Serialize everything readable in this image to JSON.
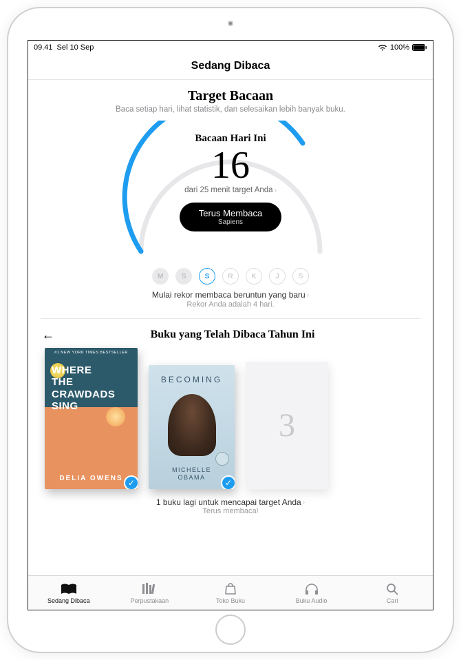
{
  "status": {
    "time": "09.41",
    "date": "Sel 10 Sep",
    "battery": "100%"
  },
  "nav": {
    "title": "Sedang Dibaca"
  },
  "goals": {
    "title": "Target Bacaan",
    "subtitle": "Baca setiap hari, lihat statistik, dan selesaikan lebih banyak buku.",
    "today_label": "Bacaan Hari Ini",
    "today_value": "16",
    "target_text": "dari 25 menit target Anda",
    "continue_label": "Terus Membaca",
    "continue_book": "Sapiens",
    "days": [
      {
        "letter": "M",
        "state": "filled"
      },
      {
        "letter": "S",
        "state": "filled"
      },
      {
        "letter": "S",
        "state": "active"
      },
      {
        "letter": "R",
        "state": ""
      },
      {
        "letter": "K",
        "state": ""
      },
      {
        "letter": "J",
        "state": ""
      },
      {
        "letter": "S",
        "state": ""
      }
    ],
    "streak_text": "Mulai rekor membaca beruntun yang baru",
    "streak_sub": "Rekor Anda adalah 4 hari."
  },
  "yearly": {
    "title": "Buku yang Telah Dibaca Tahun Ini",
    "book1": {
      "tagline": "#1 NEW YORK TIMES BESTSELLER",
      "title_lines": [
        "WHERE",
        "THE",
        "CRAWDADS",
        "SING"
      ],
      "author": "DELIA OWENS"
    },
    "book2": {
      "title": "BECOMING",
      "author_line1": "MICHELLE",
      "author_line2": "OBAMA"
    },
    "placeholder_number": "3",
    "goal_text": "1 buku lagi untuk mencapai target Anda",
    "goal_sub": "Terus membaca!"
  },
  "tabs": {
    "reading": "Sedang Dibaca",
    "library": "Perpustakaan",
    "store": "Toko Buku",
    "audio": "Buku Audio",
    "search": "Cari"
  }
}
